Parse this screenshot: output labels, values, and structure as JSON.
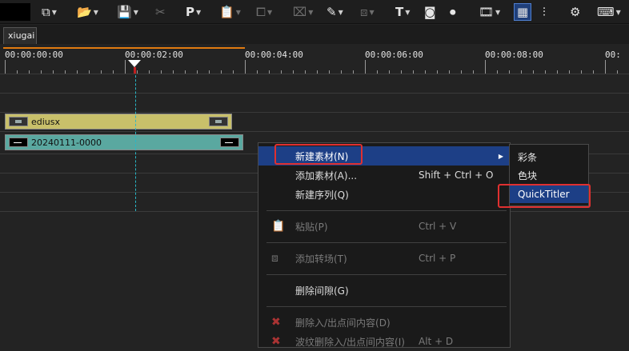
{
  "toolbar": {
    "items": [
      {
        "icon": "track-layout-icon",
        "glyph": "⧉",
        "arrow": true
      },
      {
        "icon": "folder-open-icon",
        "glyph": "📂",
        "arrow": true
      },
      {
        "icon": "save-icon",
        "glyph": "💾",
        "arrow": true
      },
      {
        "icon": "scissors-icon",
        "glyph": "✂",
        "arrow": false
      },
      {
        "icon": "paste-icon",
        "glyph": "P",
        "arrow": true
      },
      {
        "icon": "clipboard-icon",
        "glyph": "📋",
        "arrow": true
      },
      {
        "icon": "copy-icon",
        "glyph": "⧠",
        "arrow": true
      },
      {
        "icon": "delete-range-icon",
        "glyph": "⌧",
        "arrow": true
      },
      {
        "icon": "marker-icon",
        "glyph": "✎",
        "arrow": true
      },
      {
        "icon": "transition-icon",
        "glyph": "⧈",
        "arrow": true
      },
      {
        "icon": "title-icon",
        "glyph": "T",
        "arrow": true
      },
      {
        "icon": "camera-icon",
        "glyph": "◙",
        "arrow": false
      },
      {
        "icon": "voiceover-icon",
        "glyph": "⏺",
        "arrow": false
      },
      {
        "icon": "render-icon",
        "glyph": "🎞",
        "arrow": true
      },
      {
        "icon": "timeline-grid-icon",
        "glyph": "▦",
        "arrow": false
      },
      {
        "icon": "mixer-icon",
        "glyph": "⫶",
        "arrow": false
      },
      {
        "icon": "effects-icon",
        "glyph": "⚙",
        "arrow": false
      },
      {
        "icon": "keyboard-icon",
        "glyph": "⌨",
        "arrow": true
      }
    ]
  },
  "tab": {
    "label": "xiugai"
  },
  "ruler": {
    "timecodes": [
      "00:00:00:00",
      "00:00:02:00",
      "00:00:04:00",
      "00:00:06:00",
      "00:00:08:00",
      "00:"
    ]
  },
  "clips": [
    {
      "label": "ediusx",
      "color": "#c8c06a"
    },
    {
      "label": "20240111-0000",
      "color": "#5aa8a0"
    }
  ],
  "context_menu": {
    "items": [
      {
        "label": "新建素材(N)",
        "shortcut": "",
        "highlight": true,
        "disabled": false,
        "submenu": true
      },
      {
        "label": "添加素材(A)...",
        "shortcut": "Shift + Ctrl + O",
        "highlight": false,
        "disabled": false
      },
      {
        "label": "新建序列(Q)",
        "shortcut": "",
        "highlight": false,
        "disabled": false
      },
      {
        "label": "粘贴(P)",
        "shortcut": "Ctrl + V",
        "highlight": false,
        "disabled": true,
        "icon": "paste-icon"
      },
      {
        "label": "添加转场(T)",
        "shortcut": "Ctrl + P",
        "highlight": false,
        "disabled": true,
        "icon": "transition-icon"
      },
      {
        "label": "删除间隙(G)",
        "shortcut": "",
        "highlight": false,
        "disabled": false
      },
      {
        "label": "删除入/出点间内容(D)",
        "shortcut": "",
        "highlight": false,
        "disabled": true,
        "icon": "delete-icon"
      },
      {
        "label": "波纹删除入/出点间内容(I)",
        "shortcut": "Alt + D",
        "highlight": false,
        "disabled": true,
        "icon": "ripple-delete-icon"
      }
    ]
  },
  "submenu": {
    "items": [
      {
        "label": "彩条",
        "highlight": false
      },
      {
        "label": "色块",
        "highlight": false
      },
      {
        "label": "QuickTitler",
        "highlight": true
      }
    ]
  },
  "colors": {
    "highlight": "#1d3f86",
    "annotation": "#e03030",
    "playhead": "#2ab7c7"
  }
}
